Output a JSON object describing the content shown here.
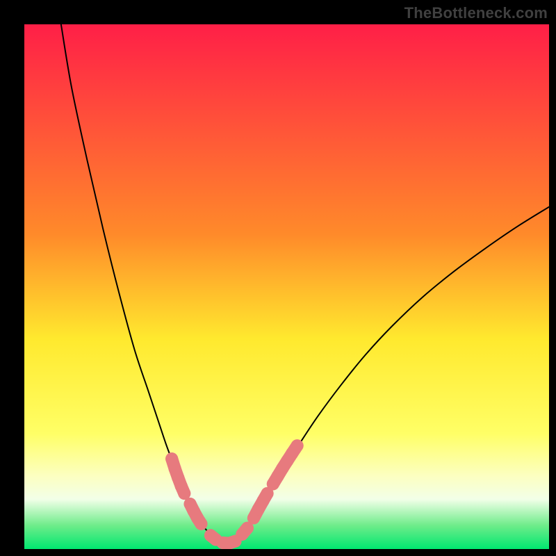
{
  "watermark": "TheBottleneck.com",
  "chart_data": {
    "type": "line",
    "title": "",
    "xlabel": "",
    "ylabel": "",
    "xlim": [
      0,
      100
    ],
    "ylim": [
      0,
      100
    ],
    "gradient_stops": [
      {
        "offset": 0,
        "color": "#ff1f47"
      },
      {
        "offset": 0.4,
        "color": "#ff8a2a"
      },
      {
        "offset": 0.6,
        "color": "#ffe92e"
      },
      {
        "offset": 0.78,
        "color": "#ffff66"
      },
      {
        "offset": 0.86,
        "color": "#fcffc0"
      },
      {
        "offset": 0.905,
        "color": "#f2ffe8"
      },
      {
        "offset": 0.955,
        "color": "#6eec8a"
      },
      {
        "offset": 1.0,
        "color": "#00e770"
      }
    ],
    "series": [
      {
        "name": "left-branch",
        "type": "curve",
        "x": [
          7,
          9,
          12,
          15,
          18,
          21,
          23.5,
          25.5,
          27,
          28.3,
          29.3,
          30.2,
          31,
          31.8,
          32.6,
          33.4,
          34.3
        ],
        "y": [
          100,
          88,
          74,
          61,
          49,
          38,
          30.5,
          24.5,
          20,
          16.5,
          13.7,
          11.4,
          9.6,
          8.0,
          6.5,
          5.2,
          4.1
        ]
      },
      {
        "name": "valley",
        "type": "curve",
        "x": [
          34.3,
          35.8,
          37.3,
          38.7,
          40.0,
          41.3,
          42.7
        ],
        "y": [
          4.1,
          2.4,
          1.4,
          1.1,
          1.4,
          2.6,
          4.5
        ]
      },
      {
        "name": "right-branch",
        "type": "curve",
        "x": [
          42.7,
          44.4,
          46.6,
          49.2,
          52.4,
          56.0,
          60.3,
          65.0,
          70.0,
          76.0,
          82.0,
          88.0,
          94.0,
          100.0
        ],
        "y": [
          4.5,
          7.2,
          10.8,
          15.0,
          20.0,
          25.4,
          31.2,
          37.0,
          42.4,
          48.1,
          53.0,
          57.4,
          61.5,
          65.2
        ]
      }
    ],
    "markers": {
      "color": "#e77a7e",
      "radius_pct": 1.2,
      "groups": [
        {
          "name": "left-upper-dots",
          "points": [
            {
              "x": 28.1,
              "y": 17.2
            },
            {
              "x": 28.7,
              "y": 15.3
            },
            {
              "x": 29.3,
              "y": 13.6
            },
            {
              "x": 29.9,
              "y": 12.0
            },
            {
              "x": 30.5,
              "y": 10.6
            }
          ]
        },
        {
          "name": "left-lower-dots",
          "points": [
            {
              "x": 31.6,
              "y": 8.6
            },
            {
              "x": 32.3,
              "y": 7.2
            },
            {
              "x": 33.0,
              "y": 5.9
            },
            {
              "x": 33.7,
              "y": 4.8
            }
          ]
        },
        {
          "name": "left-valley-dots",
          "points": [
            {
              "x": 35.5,
              "y": 2.6
            },
            {
              "x": 36.5,
              "y": 1.8
            }
          ]
        },
        {
          "name": "bottom-dots",
          "points": [
            {
              "x": 37.8,
              "y": 1.2
            },
            {
              "x": 39.0,
              "y": 1.1
            },
            {
              "x": 40.2,
              "y": 1.5
            }
          ]
        },
        {
          "name": "right-valley-dots",
          "points": [
            {
              "x": 41.5,
              "y": 2.8
            },
            {
              "x": 42.5,
              "y": 4.0
            }
          ]
        },
        {
          "name": "right-lower-dots",
          "points": [
            {
              "x": 43.7,
              "y": 5.9
            },
            {
              "x": 44.6,
              "y": 7.6
            },
            {
              "x": 45.5,
              "y": 9.2
            },
            {
              "x": 46.3,
              "y": 10.6
            }
          ]
        },
        {
          "name": "right-upper-dots",
          "points": [
            {
              "x": 47.4,
              "y": 12.4
            },
            {
              "x": 48.3,
              "y": 13.9
            },
            {
              "x": 49.2,
              "y": 15.4
            },
            {
              "x": 50.1,
              "y": 16.8
            },
            {
              "x": 51.0,
              "y": 18.2
            },
            {
              "x": 52.0,
              "y": 19.7
            }
          ]
        }
      ]
    }
  }
}
